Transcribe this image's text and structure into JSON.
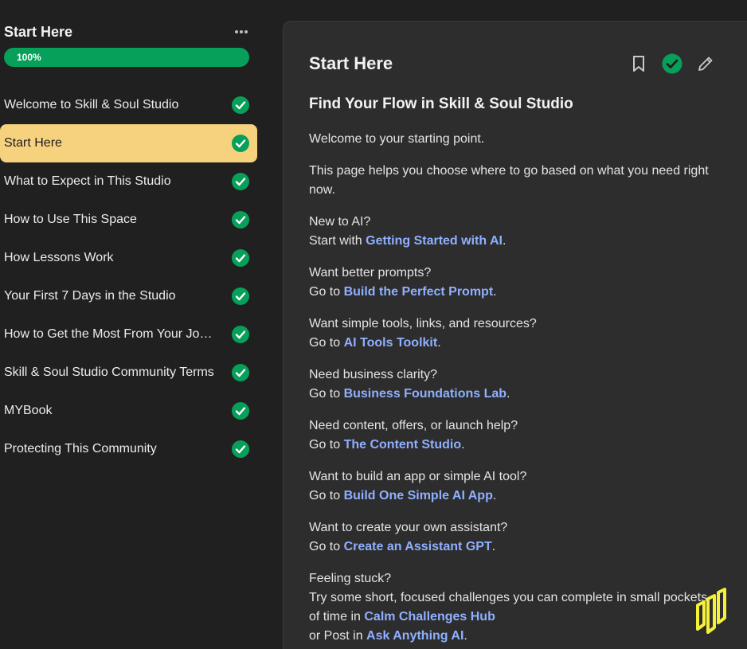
{
  "sidebar": {
    "title": "Start Here",
    "progress_label": "100%",
    "progress_value": 1.0,
    "items": [
      {
        "label": "Welcome to Skill & Soul Studio",
        "completed": true
      },
      {
        "label": "Start Here",
        "completed": true,
        "active": true
      },
      {
        "label": "What to Expect in This Studio",
        "completed": true
      },
      {
        "label": "How to Use This Space",
        "completed": true
      },
      {
        "label": "How Lessons Work",
        "completed": true
      },
      {
        "label": "Your First 7 Days in the Studio",
        "completed": true
      },
      {
        "label": "How to Get the Most From Your Jou…",
        "completed": true
      },
      {
        "label": "Skill & Soul Studio Community Terms",
        "completed": true
      },
      {
        "label": "MYBook",
        "completed": true
      },
      {
        "label": "Protecting This Community",
        "completed": true
      }
    ]
  },
  "main": {
    "title": "Start Here",
    "heading": "Find Your Flow in Skill & Soul Studio",
    "intro": "Welcome to your starting point.",
    "intro2": "This page helps you choose where to go based on what you need right now.",
    "sections": [
      {
        "q": "New to AI?",
        "prefix": "Start with ",
        "link": "Getting Started with AI",
        "suffix": "."
      },
      {
        "q": "Want better prompts?",
        "prefix": "Go to ",
        "link": "Build the Perfect Prompt",
        "suffix": "."
      },
      {
        "q": "Want simple tools, links, and resources?",
        "prefix": "Go to ",
        "link": "AI Tools Toolkit",
        "suffix": "."
      },
      {
        "q": "Need business clarity?",
        "prefix": "Go to ",
        "link": "Business Foundations Lab",
        "suffix": "."
      },
      {
        "q": "Need content, offers, or launch help?",
        "prefix": "Go to ",
        "link": "The Content Studio",
        "suffix": "."
      },
      {
        "q": "Want to build an app or simple AI tool?",
        "prefix": "Go to ",
        "link": "Build One Simple AI App",
        "suffix": "."
      },
      {
        "q": "Want to create your own assistant?",
        "prefix": "Go to ",
        "link": "Create an Assistant GPT",
        "suffix": "."
      }
    ],
    "stuck": {
      "q": "Feeling stuck?",
      "line1": "Try some short, focused challenges you can complete in small pockets",
      "line2_prefix": "of time in ",
      "line2_link": "Calm Challenges Hub",
      "line3_prefix": "or Post in ",
      "line3_link": "Ask Anything AI",
      "line3_suffix": "."
    }
  },
  "colors": {
    "accent_green": "#07a05a",
    "active_item": "#f6d27f",
    "link": "#8fb0ff",
    "logo": "#f5f03a"
  },
  "icons": {
    "more": "more-dots-icon",
    "check": "check-circle-icon",
    "bookmark": "bookmark-icon",
    "complete": "complete-check-icon",
    "edit": "pencil-icon"
  }
}
